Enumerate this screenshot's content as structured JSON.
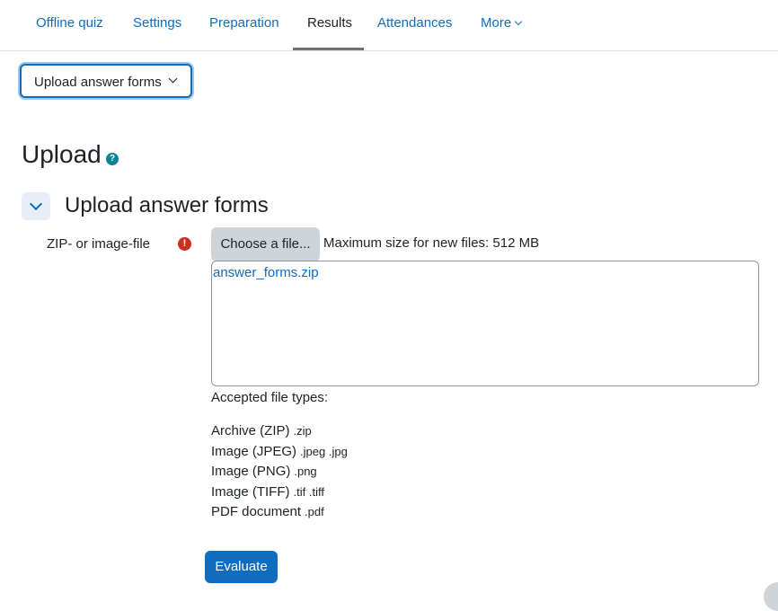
{
  "tabs": [
    {
      "label": "Offline quiz",
      "active": false
    },
    {
      "label": "Settings",
      "active": false
    },
    {
      "label": "Preparation",
      "active": false
    },
    {
      "label": "Results",
      "active": true
    },
    {
      "label": "Attendances",
      "active": false
    },
    {
      "label": "More",
      "active": false
    }
  ],
  "action_select": {
    "value": "Upload answer forms"
  },
  "page": {
    "title": "Upload",
    "help_icon": "question-icon"
  },
  "section": {
    "title": "Upload answer forms",
    "icon": "chevron-down-icon"
  },
  "form": {
    "field_label": "ZIP- or image-file",
    "required_icon": "exclamation-icon",
    "choose_button": "Choose a file...",
    "max_size": "Maximum size for new files: 512 MB",
    "files": [
      "answer_forms.zip"
    ],
    "accepted_label": "Accepted file types:",
    "accepted_types": [
      {
        "name": "Archive (ZIP)",
        "ext": ".zip"
      },
      {
        "name": "Image (JPEG)",
        "ext": ".jpeg .jpg"
      },
      {
        "name": "Image (PNG)",
        "ext": ".png"
      },
      {
        "name": "Image (TIFF)",
        "ext": ".tif .tiff"
      },
      {
        "name": "PDF document",
        "ext": ".pdf"
      }
    ],
    "submit_label": "Evaluate"
  },
  "colors": {
    "link": "#0f6cbf",
    "primary": "#0f6cbf",
    "required": "#ca3120",
    "help": "#0d8491"
  }
}
